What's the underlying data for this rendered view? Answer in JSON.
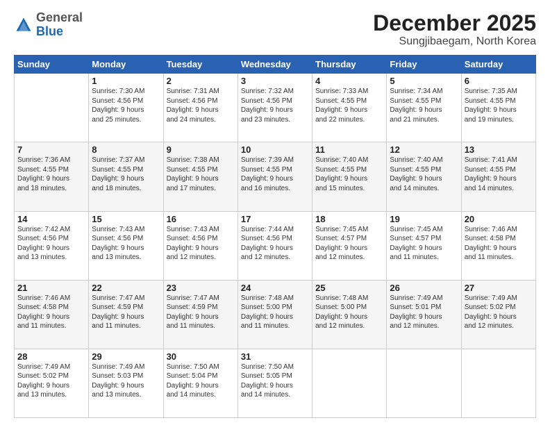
{
  "logo": {
    "general": "General",
    "blue": "Blue"
  },
  "header": {
    "month": "December 2025",
    "location": "Sungjibaegam, North Korea"
  },
  "weekdays": [
    "Sunday",
    "Monday",
    "Tuesday",
    "Wednesday",
    "Thursday",
    "Friday",
    "Saturday"
  ],
  "weeks": [
    [
      {
        "day": "",
        "info": ""
      },
      {
        "day": "1",
        "info": "Sunrise: 7:30 AM\nSunset: 4:56 PM\nDaylight: 9 hours\nand 25 minutes."
      },
      {
        "day": "2",
        "info": "Sunrise: 7:31 AM\nSunset: 4:56 PM\nDaylight: 9 hours\nand 24 minutes."
      },
      {
        "day": "3",
        "info": "Sunrise: 7:32 AM\nSunset: 4:56 PM\nDaylight: 9 hours\nand 23 minutes."
      },
      {
        "day": "4",
        "info": "Sunrise: 7:33 AM\nSunset: 4:55 PM\nDaylight: 9 hours\nand 22 minutes."
      },
      {
        "day": "5",
        "info": "Sunrise: 7:34 AM\nSunset: 4:55 PM\nDaylight: 9 hours\nand 21 minutes."
      },
      {
        "day": "6",
        "info": "Sunrise: 7:35 AM\nSunset: 4:55 PM\nDaylight: 9 hours\nand 19 minutes."
      }
    ],
    [
      {
        "day": "7",
        "info": "Sunrise: 7:36 AM\nSunset: 4:55 PM\nDaylight: 9 hours\nand 18 minutes."
      },
      {
        "day": "8",
        "info": "Sunrise: 7:37 AM\nSunset: 4:55 PM\nDaylight: 9 hours\nand 18 minutes."
      },
      {
        "day": "9",
        "info": "Sunrise: 7:38 AM\nSunset: 4:55 PM\nDaylight: 9 hours\nand 17 minutes."
      },
      {
        "day": "10",
        "info": "Sunrise: 7:39 AM\nSunset: 4:55 PM\nDaylight: 9 hours\nand 16 minutes."
      },
      {
        "day": "11",
        "info": "Sunrise: 7:40 AM\nSunset: 4:55 PM\nDaylight: 9 hours\nand 15 minutes."
      },
      {
        "day": "12",
        "info": "Sunrise: 7:40 AM\nSunset: 4:55 PM\nDaylight: 9 hours\nand 14 minutes."
      },
      {
        "day": "13",
        "info": "Sunrise: 7:41 AM\nSunset: 4:55 PM\nDaylight: 9 hours\nand 14 minutes."
      }
    ],
    [
      {
        "day": "14",
        "info": "Sunrise: 7:42 AM\nSunset: 4:56 PM\nDaylight: 9 hours\nand 13 minutes."
      },
      {
        "day": "15",
        "info": "Sunrise: 7:43 AM\nSunset: 4:56 PM\nDaylight: 9 hours\nand 13 minutes."
      },
      {
        "day": "16",
        "info": "Sunrise: 7:43 AM\nSunset: 4:56 PM\nDaylight: 9 hours\nand 12 minutes."
      },
      {
        "day": "17",
        "info": "Sunrise: 7:44 AM\nSunset: 4:56 PM\nDaylight: 9 hours\nand 12 minutes."
      },
      {
        "day": "18",
        "info": "Sunrise: 7:45 AM\nSunset: 4:57 PM\nDaylight: 9 hours\nand 12 minutes."
      },
      {
        "day": "19",
        "info": "Sunrise: 7:45 AM\nSunset: 4:57 PM\nDaylight: 9 hours\nand 11 minutes."
      },
      {
        "day": "20",
        "info": "Sunrise: 7:46 AM\nSunset: 4:58 PM\nDaylight: 9 hours\nand 11 minutes."
      }
    ],
    [
      {
        "day": "21",
        "info": "Sunrise: 7:46 AM\nSunset: 4:58 PM\nDaylight: 9 hours\nand 11 minutes."
      },
      {
        "day": "22",
        "info": "Sunrise: 7:47 AM\nSunset: 4:59 PM\nDaylight: 9 hours\nand 11 minutes."
      },
      {
        "day": "23",
        "info": "Sunrise: 7:47 AM\nSunset: 4:59 PM\nDaylight: 9 hours\nand 11 minutes."
      },
      {
        "day": "24",
        "info": "Sunrise: 7:48 AM\nSunset: 5:00 PM\nDaylight: 9 hours\nand 11 minutes."
      },
      {
        "day": "25",
        "info": "Sunrise: 7:48 AM\nSunset: 5:00 PM\nDaylight: 9 hours\nand 12 minutes."
      },
      {
        "day": "26",
        "info": "Sunrise: 7:49 AM\nSunset: 5:01 PM\nDaylight: 9 hours\nand 12 minutes."
      },
      {
        "day": "27",
        "info": "Sunrise: 7:49 AM\nSunset: 5:02 PM\nDaylight: 9 hours\nand 12 minutes."
      }
    ],
    [
      {
        "day": "28",
        "info": "Sunrise: 7:49 AM\nSunset: 5:02 PM\nDaylight: 9 hours\nand 13 minutes."
      },
      {
        "day": "29",
        "info": "Sunrise: 7:49 AM\nSunset: 5:03 PM\nDaylight: 9 hours\nand 13 minutes."
      },
      {
        "day": "30",
        "info": "Sunrise: 7:50 AM\nSunset: 5:04 PM\nDaylight: 9 hours\nand 14 minutes."
      },
      {
        "day": "31",
        "info": "Sunrise: 7:50 AM\nSunset: 5:05 PM\nDaylight: 9 hours\nand 14 minutes."
      },
      {
        "day": "",
        "info": ""
      },
      {
        "day": "",
        "info": ""
      },
      {
        "day": "",
        "info": ""
      }
    ]
  ]
}
